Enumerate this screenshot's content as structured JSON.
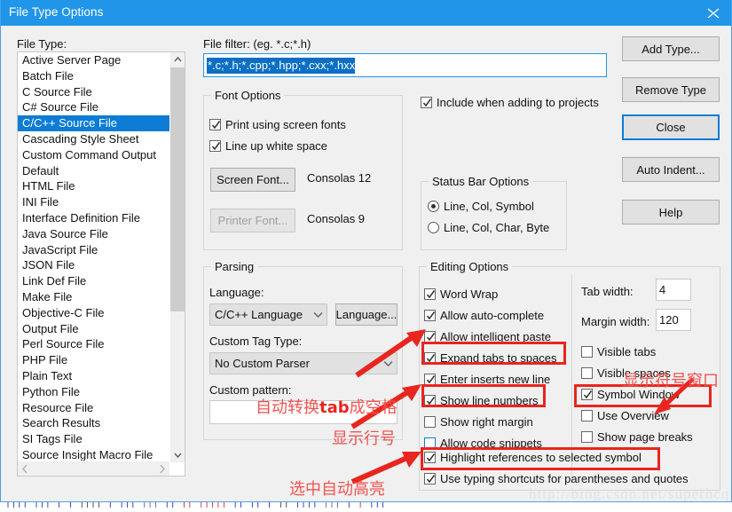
{
  "window": {
    "title": "File Type Options",
    "close_icon": "close-icon"
  },
  "file_type": {
    "label": "File Type:",
    "selected": "C/C++ Source File",
    "items": [
      "Active Server Page",
      "Batch File",
      "C Source File",
      "C# Source File",
      "C/C++ Source File",
      "Cascading Style Sheet",
      "Custom Command Output",
      "Default",
      "HTML File",
      "INI File",
      "Interface Definition File",
      "Java Source File",
      "JavaScript File",
      "JSON File",
      "Link Def File",
      "Make File",
      "Objective-C File",
      "Output File",
      "Perl Source File",
      "PHP File",
      "Plain Text",
      "Python File",
      "Resource File",
      "Search Results",
      "SI Tags File",
      "Source Insight Macro File"
    ]
  },
  "file_filter": {
    "label": "File filter: (eg. *.c;*.h)",
    "value": "*.c;*.h;*.cpp;*.hpp;*.cxx;*.hxx"
  },
  "font_options": {
    "title": "Font Options",
    "print_using_screen_fonts": {
      "label": "Print using screen fonts",
      "checked": true
    },
    "line_up_white_space": {
      "label": "Line up white space",
      "checked": true
    },
    "screen_font_button": "Screen Font...",
    "screen_font_value": "Consolas 12",
    "printer_font_button": "Printer Font...",
    "printer_font_value": "Consolas 9"
  },
  "include_when_adding": {
    "label": "Include when adding to projects",
    "checked": true
  },
  "status_bar_options": {
    "title": "Status Bar Options",
    "selected": "Line, Col, Symbol",
    "options": [
      "Line, Col, Symbol",
      "Line, Col, Char, Byte"
    ]
  },
  "parsing": {
    "title": "Parsing",
    "language_label": "Language:",
    "language_value": "C/C++ Language",
    "language_button": "Language...",
    "custom_tag_type_label": "Custom Tag Type:",
    "custom_tag_type_value": "No Custom Parser",
    "custom_pattern_label": "Custom pattern:",
    "custom_pattern_value": ""
  },
  "editing_options": {
    "title": "Editing Options",
    "left_column": [
      {
        "label": "Word Wrap",
        "checked": true,
        "highlighted": false,
        "focused": false
      },
      {
        "label": "Allow auto-complete",
        "checked": true,
        "highlighted": false,
        "focused": false
      },
      {
        "label": "Allow intelligent paste",
        "checked": true,
        "highlighted": false,
        "focused": false
      },
      {
        "label": "Expand tabs to spaces",
        "checked": true,
        "highlighted": true,
        "focused": false
      },
      {
        "label": "Enter inserts new line",
        "checked": true,
        "highlighted": false,
        "focused": false
      },
      {
        "label": "Show line numbers",
        "checked": true,
        "highlighted": true,
        "focused": false
      },
      {
        "label": "Show right margin",
        "checked": false,
        "highlighted": false,
        "focused": false
      },
      {
        "label": "Allow code snippets",
        "checked": false,
        "highlighted": false,
        "focused": true
      }
    ],
    "right_column": [
      {
        "label": "Visible tabs",
        "checked": false,
        "highlighted": false
      },
      {
        "label": "Visible spaces",
        "checked": false,
        "highlighted": false
      },
      {
        "label": "Symbol Window",
        "checked": true,
        "highlighted": true
      },
      {
        "label": "Use Overview",
        "checked": false,
        "highlighted": false
      },
      {
        "label": "Show page breaks",
        "checked": false,
        "highlighted": false
      }
    ],
    "full_width": [
      {
        "label": "Highlight references to selected symbol",
        "checked": true,
        "highlighted": true
      },
      {
        "label": "Use typing shortcuts for parentheses and quotes",
        "checked": true,
        "highlighted": false
      }
    ],
    "tab_width_label": "Tab width:",
    "tab_width_value": "4",
    "margin_width_label": "Margin width:",
    "margin_width_value": "120"
  },
  "buttons": {
    "add_type": "Add Type...",
    "remove_type": "Remove Type",
    "close": "Close",
    "auto_indent": "Auto Indent...",
    "help": "Help"
  },
  "annotations": [
    {
      "id": "ann-tab-spaces",
      "text_prefix": "自动转换",
      "text_bold": "tab",
      "text_suffix": "成空格"
    },
    {
      "id": "ann-line-numbers",
      "text": "显示行号"
    },
    {
      "id": "ann-highlight",
      "text": "选中自动高亮"
    },
    {
      "id": "ann-symbol-window",
      "text": "显示符号窗口"
    }
  ],
  "watermark": "http://blog.csdn.net/superhcq",
  "colors": {
    "title_bar": "#2196e8",
    "selection": "#0c7cd5",
    "annotation_red": "#e8251e",
    "annotation_text": "#ef5350",
    "dialog_bg": "#f0f0f0"
  }
}
